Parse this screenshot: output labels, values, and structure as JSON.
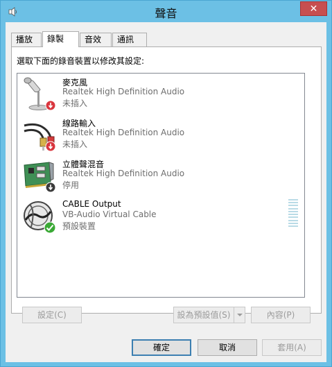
{
  "window": {
    "title": "聲音",
    "close_glyph": "✕"
  },
  "tabs": [
    {
      "label": "播放",
      "active": false
    },
    {
      "label": "錄製",
      "active": true
    },
    {
      "label": "音效",
      "active": false
    },
    {
      "label": "通訊",
      "active": false
    }
  ],
  "instruction": "選取下面的錄音裝置以修改其設定:",
  "devices": [
    {
      "name": "麥克風",
      "description": "Realtek High Definition Audio",
      "status": "未插入",
      "icon": "microphone-icon",
      "badge": "unplugged-badge-icon"
    },
    {
      "name": "線路輸入",
      "description": "Realtek High Definition Audio",
      "status": "未插入",
      "icon": "rca-cable-icon",
      "badge": "unplugged-badge-icon"
    },
    {
      "name": "立體聲混音",
      "description": "Realtek High Definition Audio",
      "status": "停用",
      "icon": "sound-card-icon",
      "badge": "disabled-badge-icon"
    },
    {
      "name": "CABLE Output",
      "description": "VB-Audio Virtual Cable",
      "status": "預設裝置",
      "icon": "cable-device-icon",
      "badge": "default-check-icon"
    }
  ],
  "buttons": {
    "configure": "設定(C)",
    "set_default": "設為預設值(S)",
    "properties": "內容(P)",
    "ok": "確定",
    "cancel": "取消",
    "apply": "套用(A)"
  },
  "colors": {
    "title_bar": "#6cc0e5",
    "close_button": "#c74f50",
    "level_meter": "#b9dbe6",
    "default_check": "#3aa935",
    "red_badge": "#d9363e"
  }
}
